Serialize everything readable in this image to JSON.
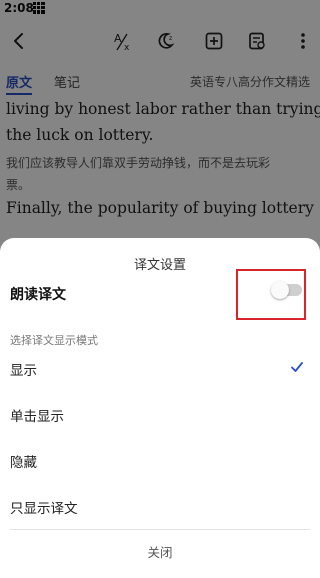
{
  "status_bar": {
    "time": "2:08"
  },
  "toolbar": {
    "icons": [
      "back-arrow-icon",
      "translate-icon",
      "night-mode-icon",
      "add-note-icon",
      "reader-settings-icon",
      "more-icon"
    ],
    "translate_glyph": "A/x"
  },
  "tabs": {
    "original": "原文",
    "notes": "笔记",
    "book_title": "英语专八高分作文精选"
  },
  "content": {
    "en_line_1": "living by honest labor rather than trying",
    "en_line_2": "the luck on lottery.",
    "zh_line_1": "我们应该教导人们靠双手劳动挣钱，而不是去玩彩",
    "zh_line_2": "票。",
    "en_line_3": "Finally, the popularity of buying lottery"
  },
  "sheet": {
    "title": "译文设置",
    "read_translation_label": "朗读译文",
    "read_translation_enabled": false,
    "mode_caption": "选择译文显示模式",
    "options": [
      "显示",
      "单击显示",
      "隐藏",
      "只显示译文"
    ],
    "selected_option": "显示",
    "close_label": "关闭"
  },
  "colors": {
    "accent": "#2a4fc4",
    "highlight": "#d9232d",
    "overlay": "rgba(0,0,0,0.48)"
  }
}
